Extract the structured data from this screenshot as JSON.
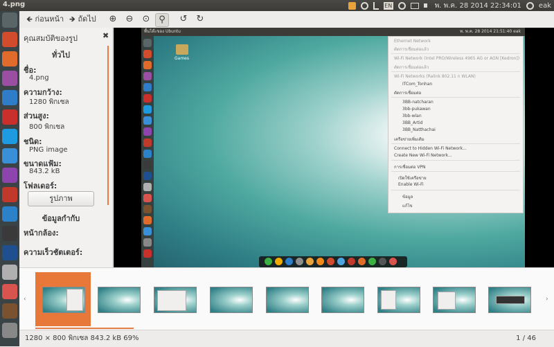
{
  "window": {
    "title": "4.png"
  },
  "top_panel": {
    "lang": "EN",
    "datetime": "พ. พ.ค. 28 2014 22:34:01",
    "user": "eak"
  },
  "toolbar": {
    "back_label": "ก่อนหน้า",
    "next_label": "ถัดไป"
  },
  "sidebar": {
    "header": "คุณสมบัติของรูป",
    "general_section": "ทั่วไป",
    "name_label": "ชื่อ:",
    "name_value": "4.png",
    "width_label": "ความกว้าง:",
    "width_value": "1280 พิกเซล",
    "height_label": "ส่วนสูง:",
    "height_value": "800 พิกเซล",
    "type_label": "ชนิด:",
    "type_value": "PNG image",
    "size_label": "ขนาดแฟ้ม:",
    "size_value": "843.2 kB",
    "folder_label": "โฟลเดอร์:",
    "folder_button": "รูปภาพ",
    "details_section": "ข้อมูลกำกับ",
    "camera_label": "หน้ากล้อง:",
    "shutter_label": "ความเร็วชัตเตอร์:"
  },
  "screenshot": {
    "panel_title": "พื้นโต๊ะของ Ubuntu",
    "panel_right": "พ. พ.ค. 28 2014 21:51:40   eak",
    "folder_name": "Games",
    "menu_items": [
      "Ethernet Network",
      "ตัดการเชื่อมต่อแล้ว",
      "Wi-Fi Network (Intel PRO/Wireless 4965 AG or AGN [Kedron])",
      "ตัดการเชื่อมต่อแล้ว",
      "Wi-Fi Networks (Ralink 802.11 n WLAN)",
      "ITCom_Tonhan",
      "ตัดการเชื่อมต่อ",
      "3BB-natcharan",
      "3bb-pukawan",
      "3bb-wlan",
      "3BB_Artid",
      "3BB_Natthachai",
      "เครือข่ายเพิ่มเติม",
      "Connect to Hidden Wi-Fi Network...",
      "Create New Wi-Fi Network...",
      "การเชื่อมต่อ VPN",
      "เปิดใช้เครือข่าย",
      "Enable Wi-Fi",
      "ข้อมูล",
      "แก้ไข"
    ]
  },
  "filmstrip": {
    "prev_arrow": "‹",
    "next_arrow": "›"
  },
  "status": {
    "info": "1280 × 800 พิกเซล  843.2 kB  69%",
    "counter": "1 / 46"
  },
  "colors": {
    "accent": "#e8773a",
    "panel": "#3c3b37",
    "launcher": "#3a4447"
  }
}
